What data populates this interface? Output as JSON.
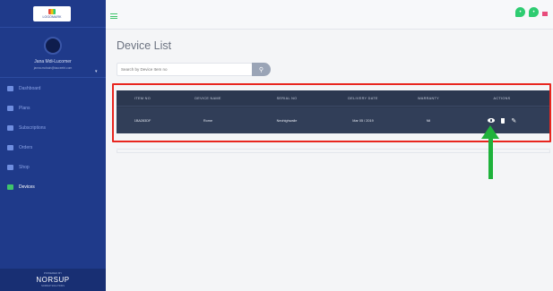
{
  "app": {
    "logo_text": "LOGOMARK"
  },
  "user": {
    "name": "Jana Mdi-Lucomer",
    "email": "janna.mcbain@tacceebt.com"
  },
  "sidebar": {
    "items": [
      {
        "label": "Dashboard",
        "icon": "dashboard-icon",
        "active": false
      },
      {
        "label": "Plans",
        "icon": "list-icon",
        "active": false
      },
      {
        "label": "Subscriptions",
        "icon": "subscriptions-icon",
        "active": false
      },
      {
        "label": "Orders",
        "icon": "orders-icon",
        "active": false
      },
      {
        "label": "Shop",
        "icon": "shop-icon",
        "active": false
      },
      {
        "label": "Devices",
        "icon": "cart-icon",
        "active": true
      }
    ],
    "brand_top": "POWERED BY",
    "brand": "NORSUP",
    "brand_sub": "NORSUP SOLUTIONS"
  },
  "topbar": {
    "menu_icon": "hamburger-icon",
    "icons": [
      "chat-icon",
      "chat-icon",
      "flag-icon"
    ]
  },
  "main": {
    "title": "Device List",
    "search_placeholder": "Search by Device Item no",
    "search_icon": "search-icon"
  },
  "table": {
    "headers": [
      "ITEM NO",
      "DEVICE NAME",
      "SERIAL NO",
      "DELIVERY DATE",
      "WARRANTY",
      "ACTIONS"
    ],
    "rows": [
      {
        "item_no": "1BA283DF",
        "device_name": "Rome",
        "serial_no": "Neohighwaile",
        "delivery_date": "Mar 05 / 2019",
        "warranty": "Nil"
      }
    ],
    "actions": [
      "eye-icon",
      "trash-icon",
      "pencil-icon"
    ]
  },
  "annotation": {
    "highlight_color": "#e8261f",
    "arrow_color": "#1fb23b"
  },
  "colors": {
    "sidebar": "#1f3a8a",
    "accent": "#3fc46b",
    "table_bg": "#2c3850"
  }
}
